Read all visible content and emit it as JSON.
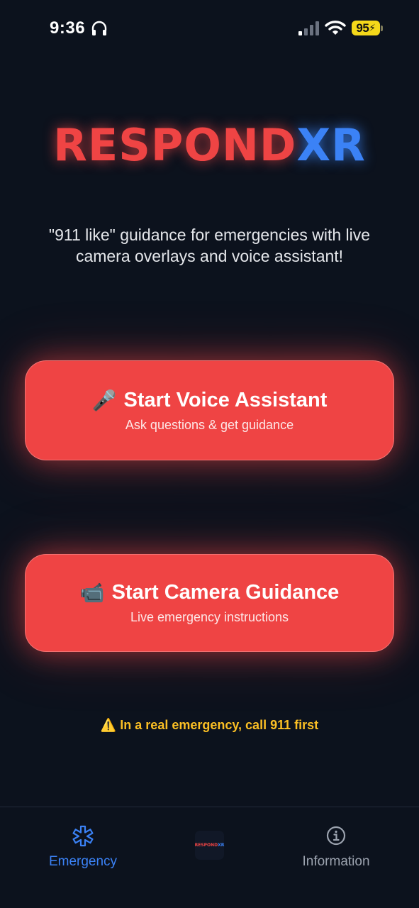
{
  "status_bar": {
    "time": "9:36",
    "battery_level": "95",
    "icons": [
      "headphones-icon",
      "signal-icon",
      "wifi-icon",
      "battery-icon"
    ]
  },
  "logo": {
    "part1": "RESPOND",
    "part2": "XR",
    "colors": {
      "part1": "#ef4444",
      "part2": "#3b82f6"
    }
  },
  "tagline": "\"911 like\" guidance for emergencies with live camera overlays and voice assistant!",
  "buttons": {
    "voice": {
      "emoji": "🎤",
      "title": "Start Voice Assistant",
      "subtitle": "Ask questions & get guidance"
    },
    "camera": {
      "emoji": "📹",
      "title": "Start Camera Guidance",
      "subtitle": "Live emergency instructions"
    }
  },
  "warning": "⚠️ In a real emergency, call 911 first",
  "tab_bar": {
    "tabs": [
      {
        "label": "Emergency",
        "icon": "asterisk-icon",
        "active": true
      },
      {
        "label": "",
        "icon": "app-logo-icon",
        "active": false
      },
      {
        "label": "Information",
        "icon": "info-icon",
        "active": false
      }
    ],
    "center_logo": {
      "part1": "RESPOND",
      "part2": "XR"
    }
  },
  "colors": {
    "background": "#0c121d",
    "accent_red": "#ef4444",
    "accent_blue": "#3b82f6",
    "warning": "#fbbf24"
  }
}
